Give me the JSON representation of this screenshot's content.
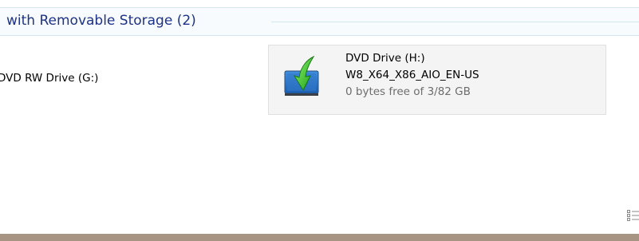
{
  "group": {
    "title": "with Removable Storage (2)"
  },
  "drives": {
    "left": {
      "name": "DVD RW Drive (G:)"
    },
    "tile": {
      "name": "DVD Drive (H:)",
      "label": "W8_X64_X86_AIO_EN-US",
      "free": "0 bytes free of 3/82 GB",
      "icon": "dvd-drive-icon"
    }
  },
  "colors": {
    "header_text": "#1e3287",
    "header_line": "#d5e6f3",
    "tile_bg": "#f4f4f4",
    "tile_border": "#e0e0e0",
    "bottom_bar": "#a89482"
  },
  "view_toggle": {
    "icon": "details-view-icon"
  }
}
